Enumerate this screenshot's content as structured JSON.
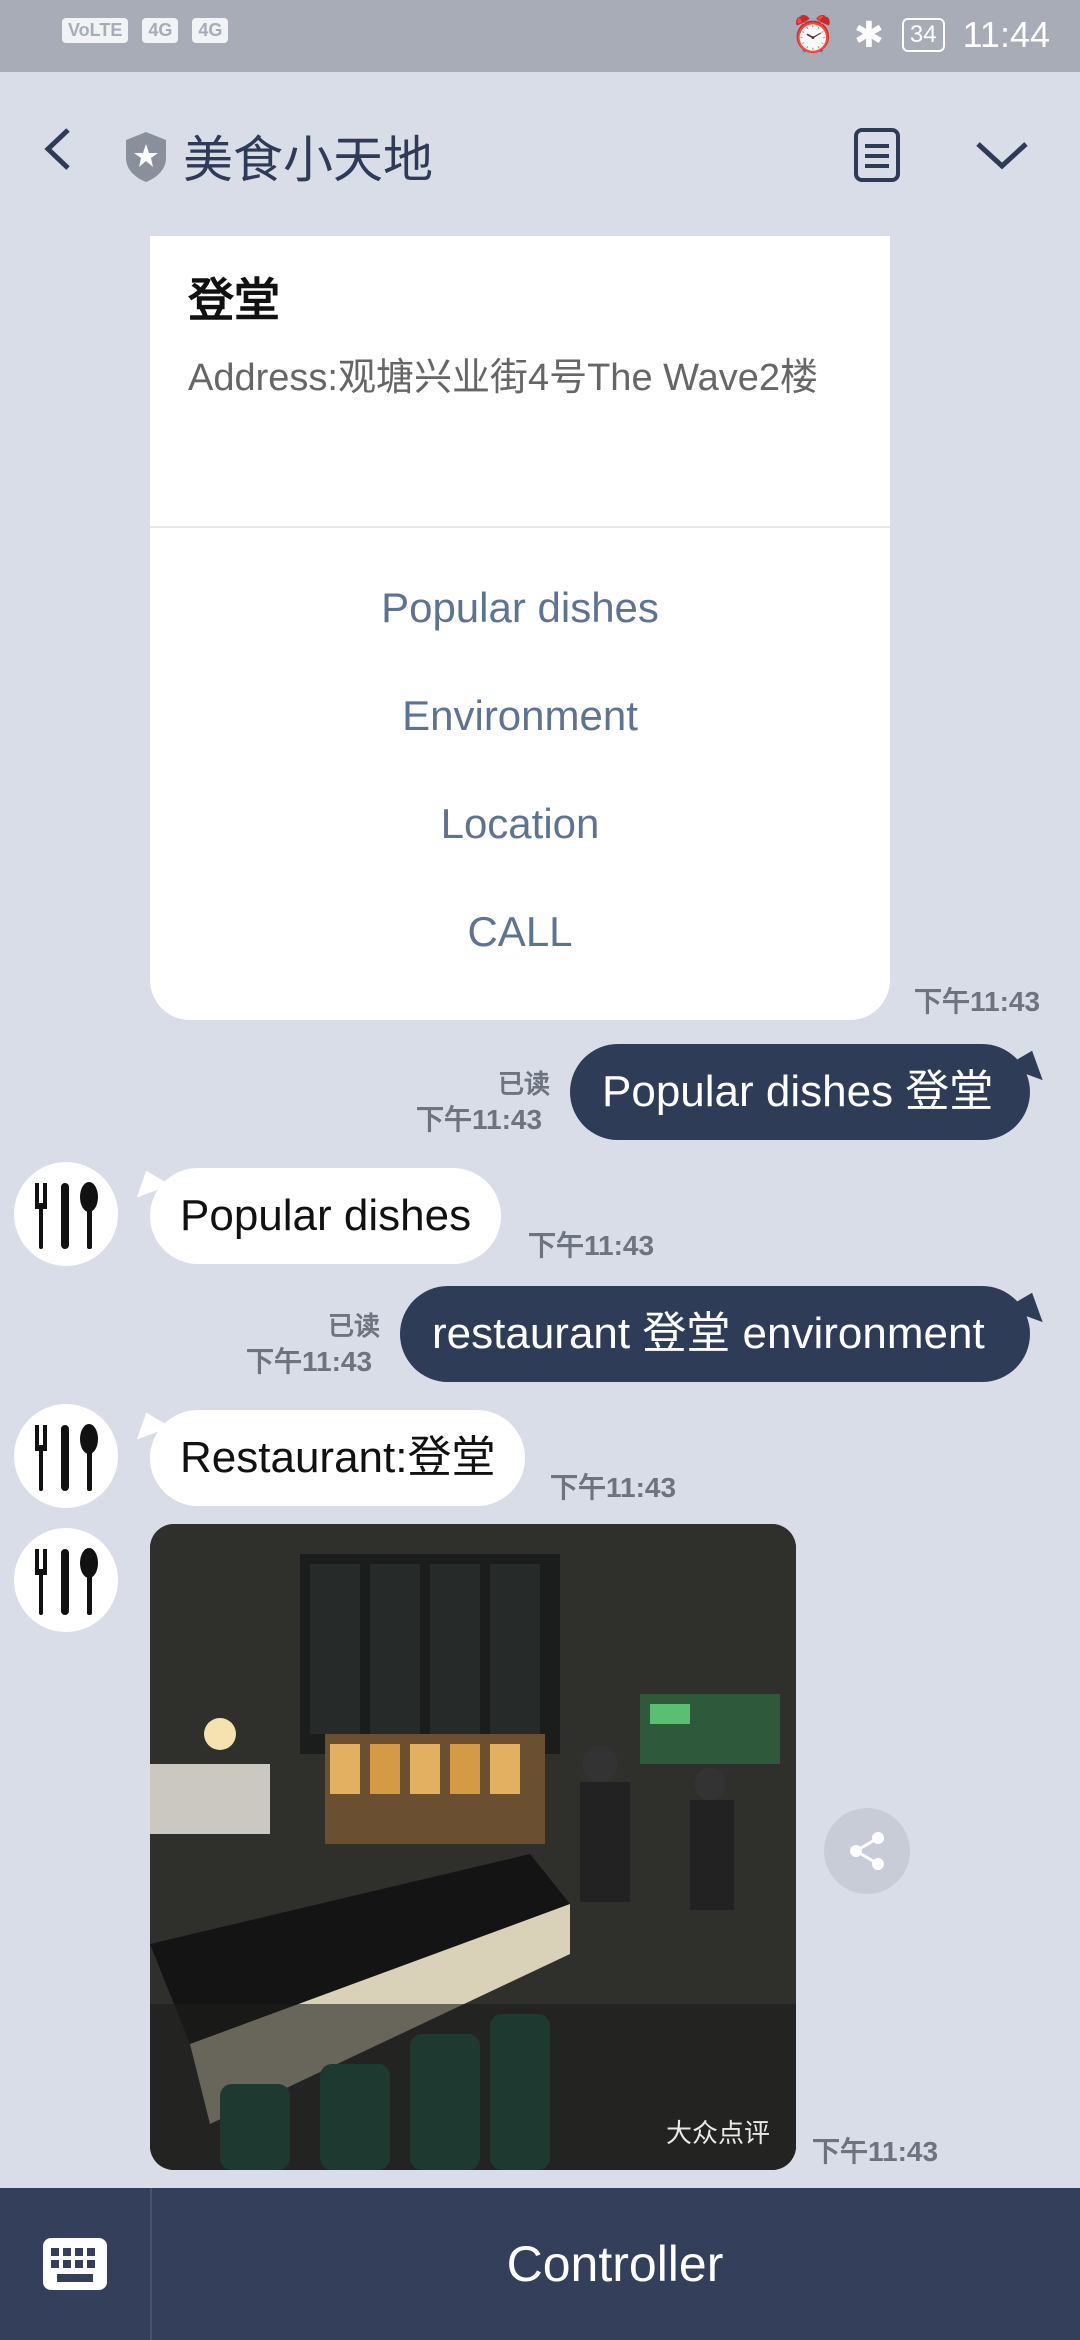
{
  "status_bar": {
    "time": "11:44",
    "battery": "34",
    "left_labels": [
      "VoLTE",
      "4G",
      "4G"
    ]
  },
  "header": {
    "title": "美食小天地"
  },
  "card": {
    "title": "登堂",
    "address": "Address:观塘兴业街4号The Wave2楼",
    "actions": [
      "Popular dishes",
      "Environment",
      "Location",
      "CALL"
    ],
    "time": "下午11:43"
  },
  "messages": {
    "m1": {
      "read": "已读",
      "time": "下午11:43",
      "text": "Popular dishes 登堂"
    },
    "m2": {
      "time": "下午11:43",
      "text": "Popular dishes"
    },
    "m3": {
      "read": "已读",
      "time": "下午11:43",
      "text": "restaurant 登堂 environment"
    },
    "m4": {
      "time": "下午11:43",
      "text": "Restaurant:登堂"
    },
    "m5": {
      "time": "下午11:43",
      "watermark": "大众点评"
    }
  },
  "bottom": {
    "label": "Controller"
  },
  "colors": {
    "background": "#d9dde8",
    "outgoing_bubble": "#2f3c58",
    "link": "#5c7394",
    "bottom_bar": "#343f5b"
  }
}
